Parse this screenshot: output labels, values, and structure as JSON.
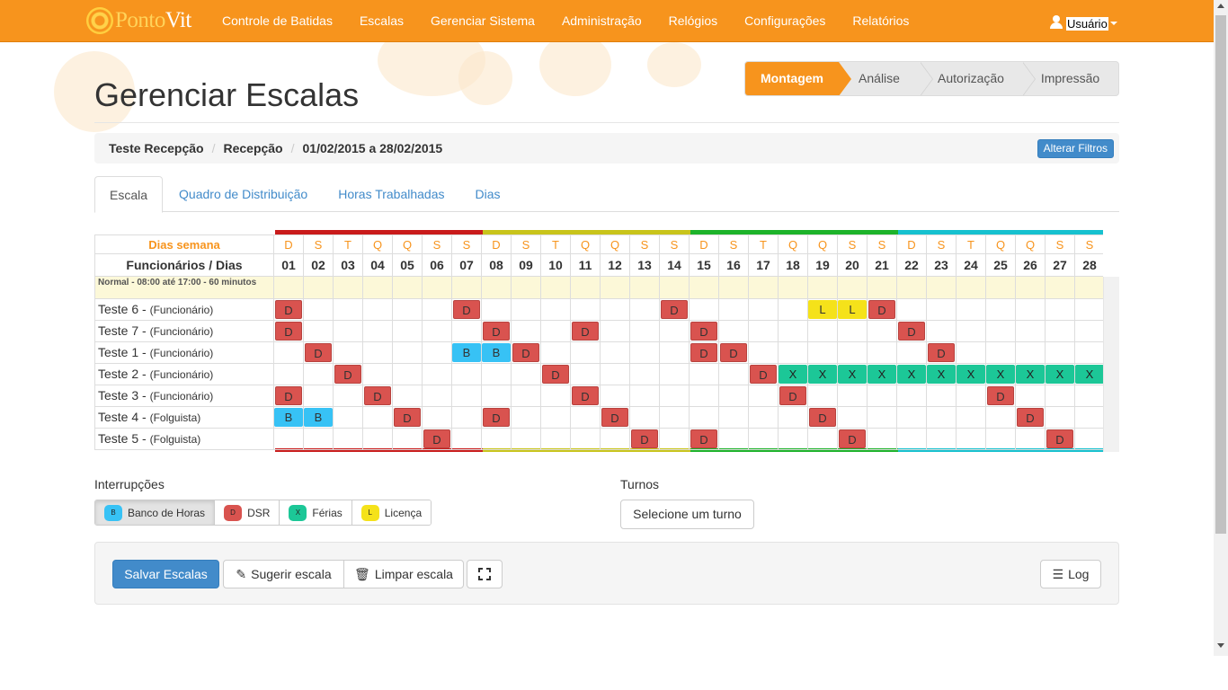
{
  "brand": {
    "name_a": "Ponto",
    "name_b": "Vit"
  },
  "nav": [
    "Controle de Batidas",
    "Escalas",
    "Gerenciar Sistema",
    "Administração",
    "Relógios",
    "Configurações",
    "Relatórios"
  ],
  "user": {
    "name": "Usuário"
  },
  "page_title": "Gerenciar Escalas",
  "steps": [
    "Montagem",
    "Análise",
    "Autorização",
    "Impressão"
  ],
  "breadcrumb": {
    "items": [
      "Teste Recepção",
      "Recepção",
      "01/02/2015 a 28/02/2015"
    ],
    "filter_button": "Alterar Filtros"
  },
  "tabs": [
    "Escala",
    "Quadro de Distribuição",
    "Horas Trabalhadas",
    "Dias"
  ],
  "grid": {
    "weekday_header": "Dias semana",
    "day_header": "Funcionários / Dias",
    "weekdays": [
      "D",
      "S",
      "T",
      "Q",
      "Q",
      "S",
      "S",
      "D",
      "S",
      "T",
      "Q",
      "Q",
      "S",
      "S",
      "D",
      "S",
      "T",
      "Q",
      "Q",
      "S",
      "S",
      "D",
      "S",
      "T",
      "Q",
      "Q",
      "S",
      "S"
    ],
    "days": [
      "01",
      "02",
      "03",
      "04",
      "05",
      "06",
      "07",
      "08",
      "09",
      "10",
      "11",
      "12",
      "13",
      "14",
      "15",
      "16",
      "17",
      "18",
      "19",
      "20",
      "21",
      "22",
      "23",
      "24",
      "25",
      "26",
      "27",
      "28"
    ],
    "week_colors": [
      "#c91b1b",
      "#c8c41b",
      "#1db32a",
      "#16c1cf"
    ],
    "shift_label": "Normal - 08:00 até 17:00 - 60 minutos",
    "employees": [
      {
        "name": "Teste 6 - ",
        "role": "(Funcionário)",
        "marks": {
          "01": "D",
          "07": "D",
          "14": "D",
          "19": "L",
          "20": "L",
          "21": "D"
        }
      },
      {
        "name": "Teste 7 - ",
        "role": "(Funcionário)",
        "marks": {
          "01": "D",
          "08": "D",
          "11": "D",
          "15": "D",
          "22": "D"
        }
      },
      {
        "name": "Teste 1 - ",
        "role": "(Funcionário)",
        "marks": {
          "02": "D",
          "07": "B",
          "08": "B",
          "09": "D",
          "15": "D",
          "16": "D",
          "23": "D"
        }
      },
      {
        "name": "Teste 2 - ",
        "role": "(Funcionário)",
        "marks": {
          "03": "D",
          "10": "D",
          "17": "D",
          "18": "X",
          "19": "X",
          "20": "X",
          "21": "X",
          "22": "X",
          "23": "X",
          "24": "X",
          "25": "X",
          "26": "X",
          "27": "X",
          "28": "X"
        }
      },
      {
        "name": "Teste 3 - ",
        "role": "(Funcionário)",
        "marks": {
          "01": "D",
          "04": "D",
          "11": "D",
          "18": "D",
          "25": "D"
        }
      },
      {
        "name": "Teste 4 - ",
        "role": "(Folguista)",
        "marks": {
          "01": "B",
          "02": "B",
          "05": "D",
          "08": "D",
          "12": "D",
          "19": "D",
          "26": "D"
        }
      },
      {
        "name": "Teste 5 - ",
        "role": "(Folguista)",
        "marks": {
          "06": "D",
          "13": "D",
          "15": "D",
          "20": "D",
          "27": "D"
        }
      }
    ]
  },
  "legend": {
    "title": "Interrupções",
    "items": [
      {
        "code": "B",
        "label": "Banco de Horas",
        "color": "#37c2f5"
      },
      {
        "code": "D",
        "label": "DSR",
        "color": "#d9534f"
      },
      {
        "code": "X",
        "label": "Férias",
        "color": "#1cc797"
      },
      {
        "code": "L",
        "label": "Licença",
        "color": "#f5e21a"
      }
    ]
  },
  "turnos": {
    "title": "Turnos",
    "button": "Selecione um turno"
  },
  "actions": {
    "save": "Salvar Escalas",
    "suggest": "Sugerir escala",
    "clear": "Limpar escala",
    "log": "Log"
  }
}
